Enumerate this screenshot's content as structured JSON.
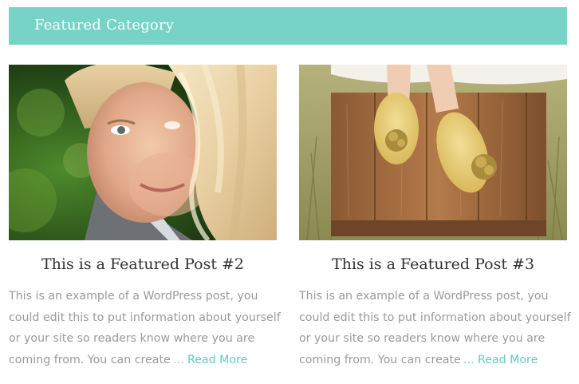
{
  "section": {
    "title": "Featured Category",
    "accent_color": "#76d3c6"
  },
  "posts": [
    {
      "title": "This is a Featured Post #2",
      "image": "portrait of a man behind a woman's blonde hair, green background",
      "excerpt_lines": [
        "This is an example of a WordPress post, you",
        "could edit this to put information about yourself",
        "or your site so readers know where you are",
        "coming from. You can create"
      ],
      "ellipsis": "…",
      "read_more": "Read More"
    },
    {
      "title": "This is a Featured Post #3",
      "image": "yellow flats with flower ornaments standing on a wooden crate in grass",
      "excerpt_lines": [
        "This is an example of a WordPress post, you",
        "could edit this to put information about yourself",
        "or your site so readers know where you are",
        "coming from. You can create"
      ],
      "ellipsis": "…",
      "read_more": "Read More"
    }
  ]
}
